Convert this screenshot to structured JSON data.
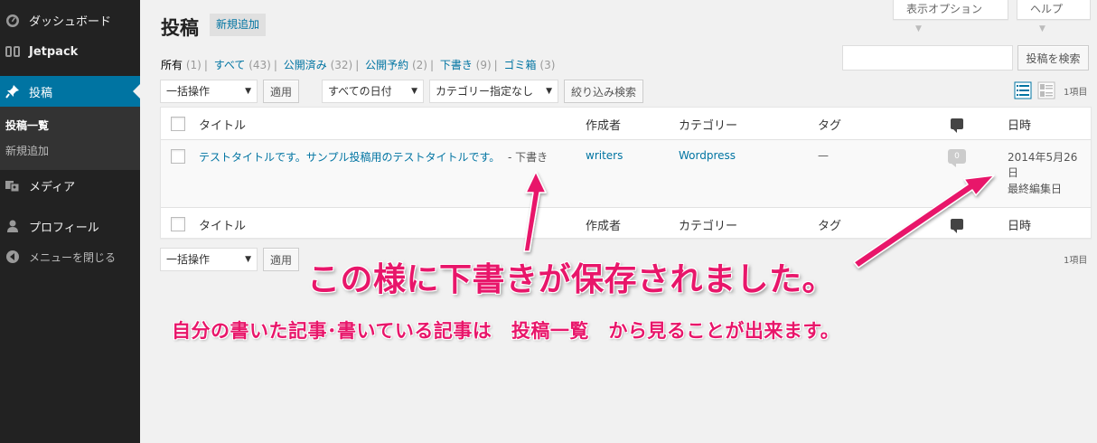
{
  "sidebar": {
    "items": [
      {
        "label": "ダッシュボード",
        "icon": "dashboard-icon"
      },
      {
        "label": "Jetpack",
        "icon": "jetpack-icon"
      },
      {
        "label": "投稿",
        "icon": "pin-icon"
      },
      {
        "label": "メディア",
        "icon": "media-icon"
      },
      {
        "label": "プロフィール",
        "icon": "user-icon"
      },
      {
        "label": "メニューを閉じる",
        "icon": "collapse-icon"
      }
    ],
    "submenu": [
      {
        "label": "投稿一覧"
      },
      {
        "label": "新規追加"
      }
    ]
  },
  "header": {
    "title": "投稿",
    "add_new": "新規追加",
    "screen_options": "表示オプション",
    "help": "ヘルプ"
  },
  "views": [
    {
      "label": "所有",
      "count": "(1)"
    },
    {
      "label": "すべて",
      "count": "(43)"
    },
    {
      "label": "公開済み",
      "count": "(32)"
    },
    {
      "label": "公開予約",
      "count": "(2)"
    },
    {
      "label": "下書き",
      "count": "(9)"
    },
    {
      "label": "ゴミ箱",
      "count": "(3)"
    }
  ],
  "search": {
    "button": "投稿を検索",
    "value": ""
  },
  "filters": {
    "bulk_action": "一括操作",
    "apply": "適用",
    "date": "すべての日付",
    "category": "カテゴリー指定なし",
    "filter_button": "絞り込み検索"
  },
  "item_count": "1項目",
  "table": {
    "columns": [
      "タイトル",
      "作成者",
      "カテゴリー",
      "タグ",
      "日時"
    ],
    "rows": [
      {
        "title": "テストタイトルです。サンプル投稿用のテストタイトルです。",
        "state": "- 下書き",
        "author": "writers",
        "category": "Wordpress",
        "tags": "—",
        "comments": "0",
        "date_line1": "2014年5月26",
        "date_line2": "日",
        "date_status": "最終編集日"
      }
    ]
  },
  "annotation": {
    "main": "この様に下書きが保存されました。",
    "sub": "自分の書いた記事･書いている記事は　投稿一覧　から見ることが出来ます。"
  },
  "colors": {
    "accent": "#0074a2",
    "annotation": "#e8166a",
    "sidebar_bg": "#222222"
  }
}
